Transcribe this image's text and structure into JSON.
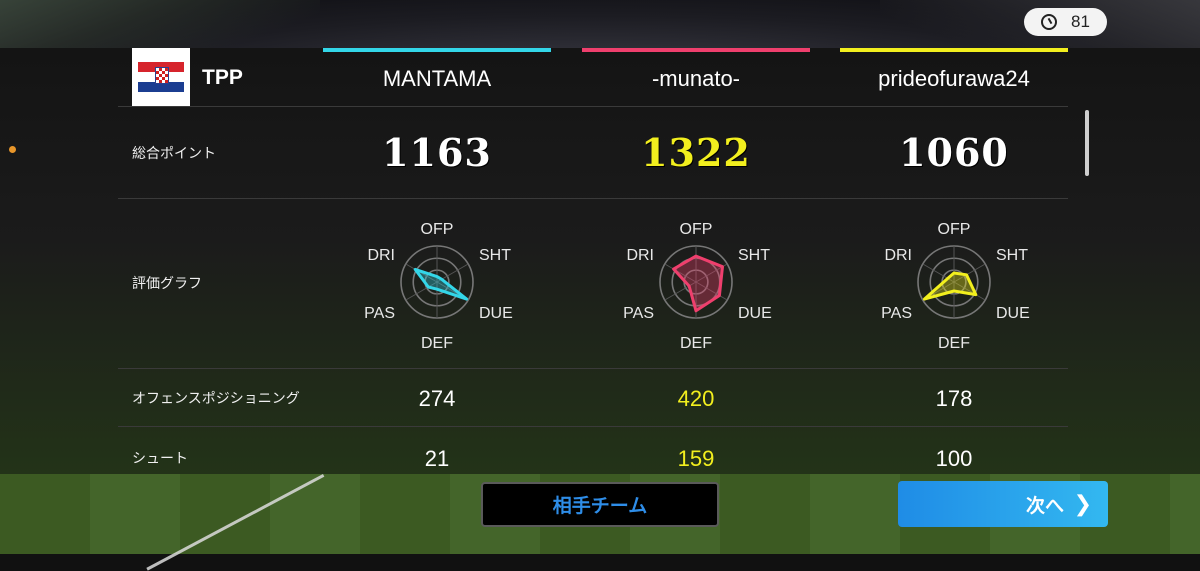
{
  "timer": {
    "value": "81"
  },
  "team": {
    "abbr": "TPP"
  },
  "players": [
    {
      "name": "MANTAMA",
      "color": "#33d6e8",
      "total": "1163",
      "offense_positioning": "274",
      "shoot": "21",
      "highlight": false,
      "radar": {
        "OFP": 0.15,
        "SHT": 0.15,
        "DUE": 0.95,
        "DEF": 0.2,
        "PAS": 0.28,
        "DRI": 0.7
      }
    },
    {
      "name": "-munato-",
      "color": "#ef3f6d",
      "total": "1322",
      "offense_positioning": "420",
      "shoot": "159",
      "highlight": true,
      "radar": {
        "OFP": 0.72,
        "SHT": 0.85,
        "DUE": 0.75,
        "DEF": 0.8,
        "PAS": 0.22,
        "DRI": 0.72
      }
    },
    {
      "name": "prideofurawa24",
      "color": "#f2ef1e",
      "total": "1060",
      "offense_positioning": "178",
      "shoot": "100",
      "highlight": false,
      "radar": {
        "OFP": 0.25,
        "SHT": 0.4,
        "DUE": 0.7,
        "DEF": 0.25,
        "PAS": 0.95,
        "DRI": 0.2
      }
    }
  ],
  "labels": {
    "total_points": "総合ポイント",
    "rating_graph": "評価グラフ",
    "offense_positioning": "オフェンスポジショニング",
    "shoot": "シュート"
  },
  "radar_axes": [
    "OFP",
    "SHT",
    "DUE",
    "DEF",
    "PAS",
    "DRI"
  ],
  "buttons": {
    "opponent_team": "相手チーム",
    "next": "次へ"
  },
  "colors": {
    "highlight": "#f2ef1e",
    "normal": "#ffffff"
  }
}
